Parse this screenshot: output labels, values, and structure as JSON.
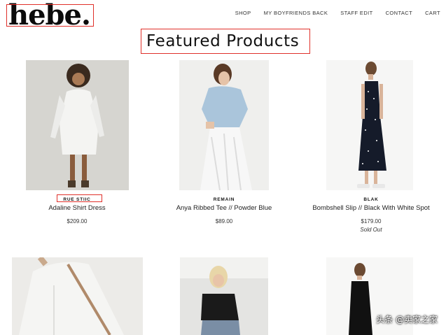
{
  "header": {
    "logo": "hebe.",
    "nav": [
      "SHOP",
      "MY BOYFRIENDS BACK",
      "STAFF EDIT",
      "CONTACT",
      "CART"
    ]
  },
  "page_title": "Featured Products",
  "products": [
    {
      "brand": "RUE STIIC",
      "name": "Adaline Shirt Dress",
      "price": "$209.00"
    },
    {
      "brand": "REMAIN",
      "name": "Anya Ribbed Tee // Powder Blue",
      "price": "$89.00"
    },
    {
      "brand": "BLAK",
      "name": "Bombshell Slip // Black With White Spot",
      "price": "$179.00",
      "status": "Sold Out"
    }
  ],
  "watermark": "头条 @卖家之家",
  "colors": {
    "highlight": "#e0302a",
    "text": "#222222"
  }
}
